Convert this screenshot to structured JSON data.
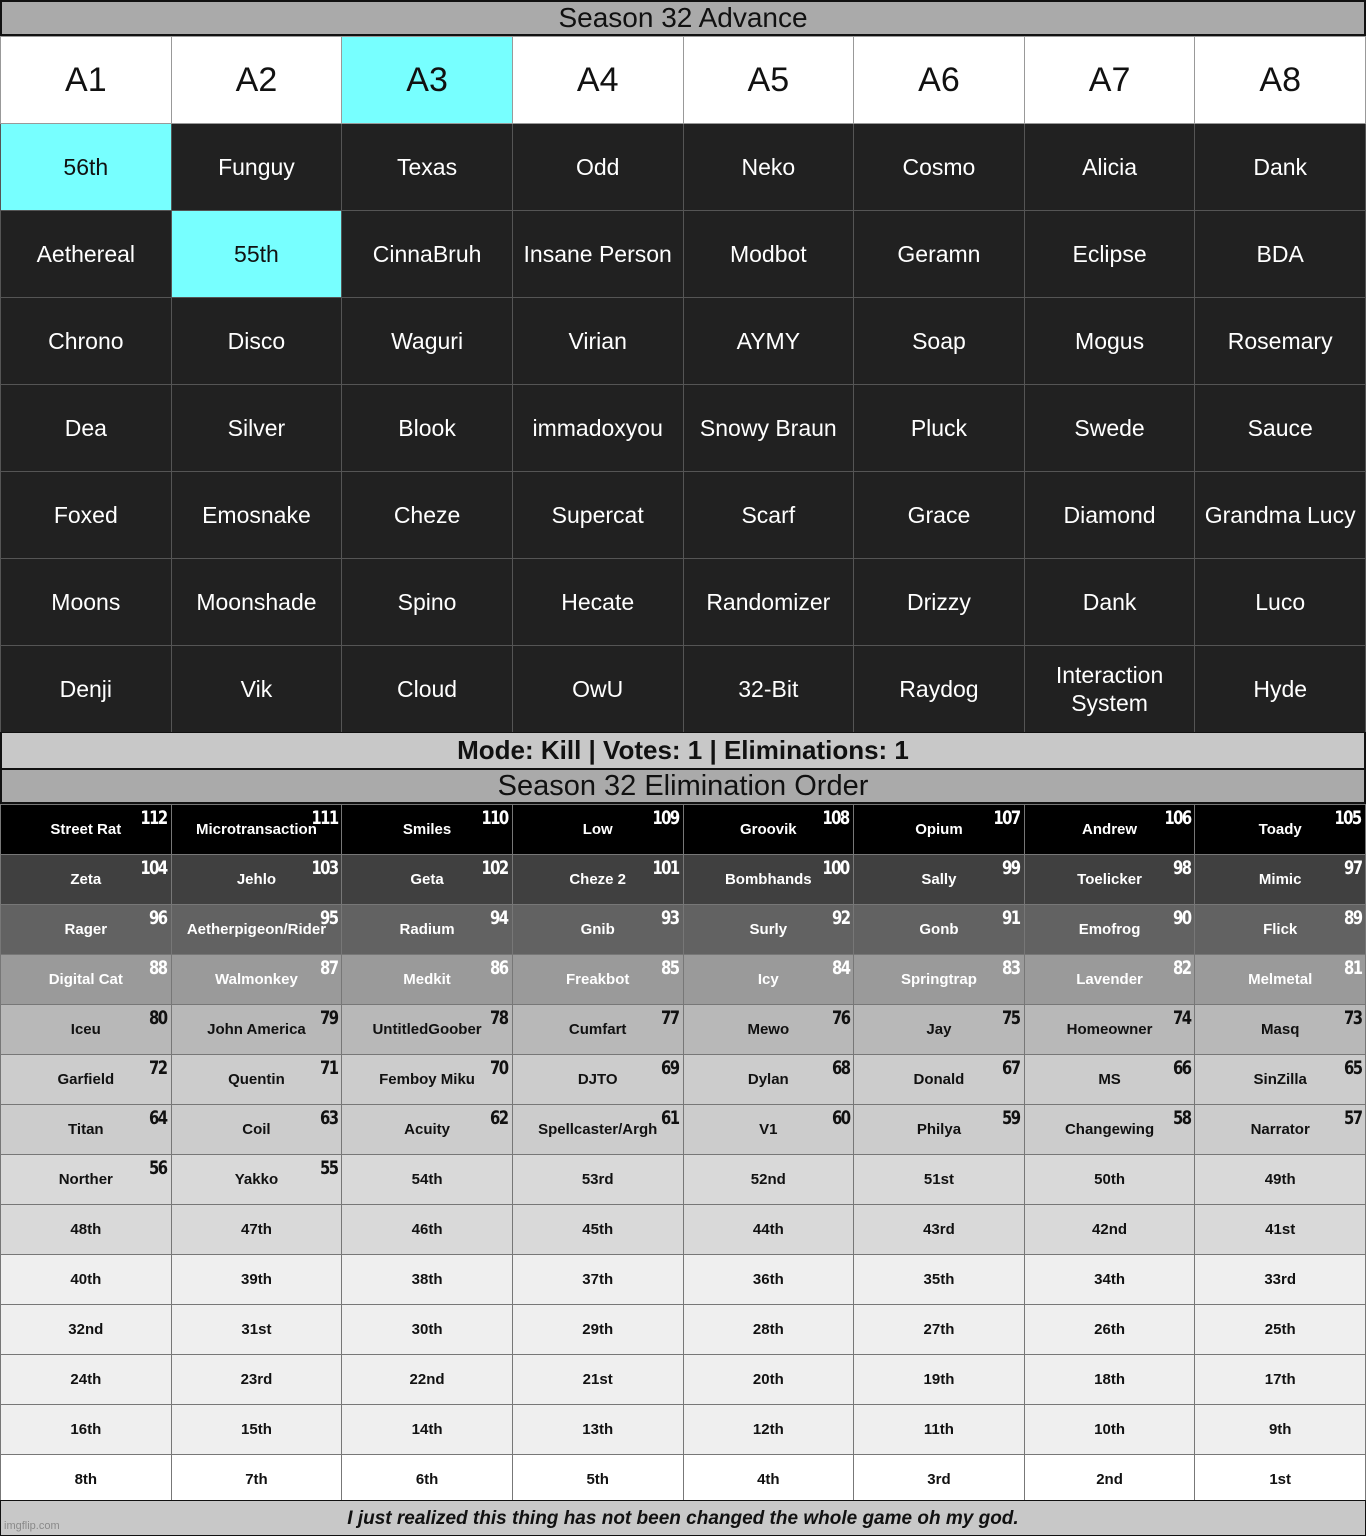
{
  "advance": {
    "title": "Season 32 Advance",
    "headers": [
      "A1",
      "A2",
      "A3",
      "A4",
      "A5",
      "A6",
      "A7",
      "A8"
    ],
    "rows": [
      [
        "56th",
        "Funguy",
        "Texas",
        "Odd",
        "Neko",
        "Cosmo",
        "Alicia",
        "Dank"
      ],
      [
        "Aethereal",
        "55th",
        "CinnaBruh",
        "Insane Person",
        "Modbot",
        "Geramn",
        "Eclipse",
        "BDA"
      ],
      [
        "Chrono",
        "Disco",
        "Waguri",
        "Virian",
        "AYMY",
        "Soap",
        "Mogus",
        "Rosemary"
      ],
      [
        "Dea",
        "Silver",
        "Blook",
        "immadoxyou",
        "Snowy Braun",
        "Pluck",
        "Swede",
        "Sauce"
      ],
      [
        "Foxed",
        "Emosnake",
        "Cheze",
        "Supercat",
        "Scarf",
        "Grace",
        "Diamond",
        "Grandma Lucy"
      ],
      [
        "Moons",
        "Moonshade",
        "Spino",
        "Hecate",
        "Randomizer",
        "Drizzy",
        "Dank",
        "Luco"
      ],
      [
        "Denji",
        "Vik",
        "Cloud",
        "OwU",
        "32-Bit",
        "Raydog",
        "Interaction System",
        "Hyde"
      ]
    ],
    "highlight_color": "#77ffff"
  },
  "mode": {
    "text": "Mode: Kill | Votes: 1 | Eliminations: 1"
  },
  "elimination": {
    "title": "Season 32 Elimination Order",
    "rows": [
      [
        {
          "name": "Street Rat",
          "num": "112"
        },
        {
          "name": "Microtransaction",
          "num": "111"
        },
        {
          "name": "Smiles",
          "num": "110"
        },
        {
          "name": "Low",
          "num": "109"
        },
        {
          "name": "Groovik",
          "num": "108"
        },
        {
          "name": "Opium",
          "num": "107"
        },
        {
          "name": "Andrew",
          "num": "106"
        },
        {
          "name": "Toady",
          "num": "105"
        }
      ],
      [
        {
          "name": "Zeta",
          "num": "104"
        },
        {
          "name": "Jehlo",
          "num": "103"
        },
        {
          "name": "Geta",
          "num": "102"
        },
        {
          "name": "Cheze 2",
          "num": "101"
        },
        {
          "name": "Bombhands",
          "num": "100"
        },
        {
          "name": "Sally",
          "num": "99"
        },
        {
          "name": "Toelicker",
          "num": "98"
        },
        {
          "name": "Mimic",
          "num": "97"
        }
      ],
      [
        {
          "name": "Rager",
          "num": "96"
        },
        {
          "name": "Aetherpigeon/Rider",
          "num": "95"
        },
        {
          "name": "Radium",
          "num": "94"
        },
        {
          "name": "Gnib",
          "num": "93"
        },
        {
          "name": "Surly",
          "num": "92"
        },
        {
          "name": "Gonb",
          "num": "91"
        },
        {
          "name": "Emofrog",
          "num": "90"
        },
        {
          "name": "Flick",
          "num": "89"
        }
      ],
      [
        {
          "name": "Digital Cat",
          "num": "88"
        },
        {
          "name": "Walmonkey",
          "num": "87"
        },
        {
          "name": "Medkit",
          "num": "86"
        },
        {
          "name": "Freakbot",
          "num": "85"
        },
        {
          "name": "Icy",
          "num": "84"
        },
        {
          "name": "Springtrap",
          "num": "83"
        },
        {
          "name": "Lavender",
          "num": "82"
        },
        {
          "name": "Melmetal",
          "num": "81"
        }
      ],
      [
        {
          "name": "Iceu",
          "num": "80"
        },
        {
          "name": "John America",
          "num": "79"
        },
        {
          "name": "UntitledGoober",
          "num": "78"
        },
        {
          "name": "Cumfart",
          "num": "77"
        },
        {
          "name": "Mewo",
          "num": "76"
        },
        {
          "name": "Jay",
          "num": "75"
        },
        {
          "name": "Homeowner",
          "num": "74"
        },
        {
          "name": "Masq",
          "num": "73"
        }
      ],
      [
        {
          "name": "Garfield",
          "num": "72"
        },
        {
          "name": "Quentin",
          "num": "71"
        },
        {
          "name": "Femboy Miku",
          "num": "70"
        },
        {
          "name": "DJTO",
          "num": "69"
        },
        {
          "name": "Dylan",
          "num": "68"
        },
        {
          "name": "Donald",
          "num": "67"
        },
        {
          "name": "MS",
          "num": "66"
        },
        {
          "name": "SinZilla",
          "num": "65"
        }
      ],
      [
        {
          "name": "Titan",
          "num": "64"
        },
        {
          "name": "Coil",
          "num": "63"
        },
        {
          "name": "Acuity",
          "num": "62"
        },
        {
          "name": "Spellcaster/Argh",
          "num": "61"
        },
        {
          "name": "V1",
          "num": "60"
        },
        {
          "name": "Philya",
          "num": "59"
        },
        {
          "name": "Changewing",
          "num": "58"
        },
        {
          "name": "Narrator",
          "num": "57"
        }
      ],
      [
        {
          "name": "Norther",
          "num": "56"
        },
        {
          "name": "Yakko",
          "num": "55"
        },
        {
          "name": "54th"
        },
        {
          "name": "53rd"
        },
        {
          "name": "52nd"
        },
        {
          "name": "51st"
        },
        {
          "name": "50th"
        },
        {
          "name": "49th"
        }
      ],
      [
        {
          "name": "48th"
        },
        {
          "name": "47th"
        },
        {
          "name": "46th"
        },
        {
          "name": "45th"
        },
        {
          "name": "44th"
        },
        {
          "name": "43rd"
        },
        {
          "name": "42nd"
        },
        {
          "name": "41st"
        }
      ],
      [
        {
          "name": "40th"
        },
        {
          "name": "39th"
        },
        {
          "name": "38th"
        },
        {
          "name": "37th"
        },
        {
          "name": "36th"
        },
        {
          "name": "35th"
        },
        {
          "name": "34th"
        },
        {
          "name": "33rd"
        }
      ],
      [
        {
          "name": "32nd"
        },
        {
          "name": "31st"
        },
        {
          "name": "30th"
        },
        {
          "name": "29th"
        },
        {
          "name": "28th"
        },
        {
          "name": "27th"
        },
        {
          "name": "26th"
        },
        {
          "name": "25th"
        }
      ],
      [
        {
          "name": "24th"
        },
        {
          "name": "23rd"
        },
        {
          "name": "22nd"
        },
        {
          "name": "21st"
        },
        {
          "name": "20th"
        },
        {
          "name": "19th"
        },
        {
          "name": "18th"
        },
        {
          "name": "17th"
        }
      ],
      [
        {
          "name": "16th"
        },
        {
          "name": "15th"
        },
        {
          "name": "14th"
        },
        {
          "name": "13th"
        },
        {
          "name": "12th"
        },
        {
          "name": "11th"
        },
        {
          "name": "10th"
        },
        {
          "name": "9th"
        }
      ],
      [
        {
          "name": "8th"
        },
        {
          "name": "7th"
        },
        {
          "name": "6th"
        },
        {
          "name": "5th"
        },
        {
          "name": "4th"
        },
        {
          "name": "3rd"
        },
        {
          "name": "2nd"
        },
        {
          "name": "1st"
        }
      ]
    ],
    "row_colors": [
      {
        "bg": "#000000",
        "fg": "#ffffff"
      },
      {
        "bg": "#404040",
        "fg": "#ffffff"
      },
      {
        "bg": "#626262",
        "fg": "#ffffff"
      },
      {
        "bg": "#9a9a9a",
        "fg": "#ffffff"
      },
      {
        "bg": "#b8b8b8",
        "fg": "#111111"
      },
      {
        "bg": "#cccccc",
        "fg": "#111111"
      },
      {
        "bg": "#cccccc",
        "fg": "#111111"
      },
      {
        "bg": "#d9d9d9",
        "fg": "#111111"
      },
      {
        "bg": "#d9d9d9",
        "fg": "#111111"
      },
      {
        "bg": "#efefef",
        "fg": "#111111"
      },
      {
        "bg": "#efefef",
        "fg": "#111111"
      },
      {
        "bg": "#efefef",
        "fg": "#111111"
      },
      {
        "bg": "#efefef",
        "fg": "#111111"
      },
      {
        "bg": "#ffffff",
        "fg": "#111111"
      }
    ]
  },
  "footer": {
    "text": "I just realized this thing has not been changed the whole game oh my god."
  },
  "watermark": "imgflip.com"
}
